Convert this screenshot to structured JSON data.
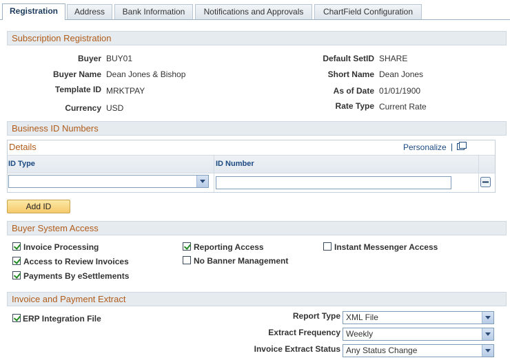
{
  "tabs": [
    {
      "label": "Registration",
      "active": true
    },
    {
      "label": "Address",
      "active": false
    },
    {
      "label": "Bank Information",
      "active": false
    },
    {
      "label": "Notifications and Approvals",
      "active": false
    },
    {
      "label": "ChartField Configuration",
      "active": false
    }
  ],
  "subscription": {
    "title": "Subscription Registration",
    "buyer_label": "Buyer",
    "buyer": "BUY01",
    "buyer_name_label": "Buyer Name",
    "buyer_name": "Dean Jones & Bishop",
    "template_id_label": "Template ID",
    "template_id": "MRKTPAY",
    "currency_label": "Currency",
    "currency": "USD",
    "default_setid_label": "Default SetID",
    "default_setid": "SHARE",
    "short_name_label": "Short Name",
    "short_name": "Dean Jones",
    "as_of_date_label": "As of Date",
    "as_of_date": "01/01/1900",
    "rate_type_label": "Rate Type",
    "rate_type": "Current Rate"
  },
  "business_id": {
    "title": "Business ID Numbers",
    "grid_title": "Details",
    "personalize": "Personalize",
    "col_id_type": "ID Type",
    "col_id_number": "ID Number",
    "row_id_type": "",
    "row_id_number": "",
    "add_button": "Add ID"
  },
  "access": {
    "title": "Buyer System Access",
    "items": [
      {
        "label": "Invoice Processing",
        "checked": true
      },
      {
        "label": "Access to Review Invoices",
        "checked": true
      },
      {
        "label": "Payments By eSettlements",
        "checked": true
      },
      {
        "label": "Reporting Access",
        "checked": true
      },
      {
        "label": "No Banner Management",
        "checked": false
      },
      {
        "label": "Instant Messenger Access",
        "checked": false
      }
    ]
  },
  "extract": {
    "title": "Invoice and Payment Extract",
    "erp_label": "ERP Integration File",
    "erp_checked": true,
    "report_type_label": "Report Type",
    "report_type": "XML File",
    "frequency_label": "Extract Frequency",
    "frequency": "Weekly",
    "status_label": "Invoice Extract Status",
    "status": "Any Status Change"
  },
  "colors": {
    "section_text": "#b05b19",
    "link": "#1b4a82",
    "section_bg": "#e6ebf0"
  }
}
